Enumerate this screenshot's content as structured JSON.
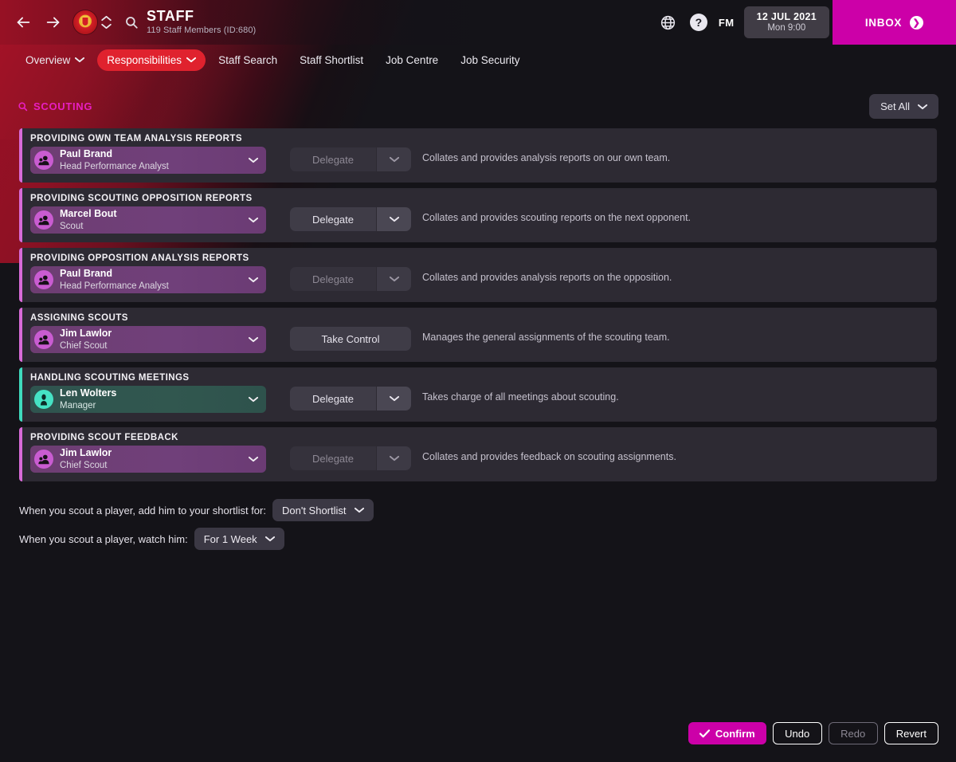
{
  "header": {
    "back_icon": "arrow-left-icon",
    "forward_icon": "arrow-right-icon",
    "club_badge": "manchester-united-badge",
    "spinner_icon": "club-switch-spinner",
    "search_icon": "search-icon",
    "title": "STAFF",
    "subtitle": "119 Staff Members (ID:680)",
    "globe_icon": "globe-icon",
    "help_icon": "help-question-icon",
    "fm_logo": "FM",
    "date_main": "12 JUL 2021",
    "date_sub": "Mon 9:00",
    "inbox_label": "INBOX",
    "inbox_icon": "chevron-right-circle-icon",
    "accent_pink": "#cc00a8",
    "accent_red": "#e0222e"
  },
  "tabs": [
    {
      "label": "Overview",
      "caret": true,
      "active": false
    },
    {
      "label": "Responsibilities",
      "caret": true,
      "active": true
    },
    {
      "label": "Staff Search",
      "caret": false,
      "active": false
    },
    {
      "label": "Staff Shortlist",
      "caret": false,
      "active": false
    },
    {
      "label": "Job Centre",
      "caret": false,
      "active": false
    },
    {
      "label": "Job Security",
      "caret": false,
      "active": false
    }
  ],
  "section": {
    "icon": "magnifier-icon",
    "title": "SCOUTING",
    "title_color": "#e81ec0",
    "set_all_label": "Set All",
    "set_all_caret": "chevron-down-icon"
  },
  "responsibilities": [
    {
      "label": "PROVIDING OWN TEAM ANALYSIS REPORTS",
      "person_name": "Paul Brand",
      "person_role": "Head Performance Analyst",
      "accent": "#d86bd8",
      "is_manager": false,
      "action_label": "Delegate",
      "action_dim": true,
      "has_caret": true,
      "description": "Collates and provides analysis reports on our own team."
    },
    {
      "label": "PROVIDING SCOUTING OPPOSITION REPORTS",
      "person_name": "Marcel Bout",
      "person_role": "Scout",
      "accent": "#d86bd8",
      "is_manager": false,
      "action_label": "Delegate",
      "action_dim": false,
      "has_caret": true,
      "description": "Collates and provides scouting reports on the next opponent."
    },
    {
      "label": "PROVIDING OPPOSITION ANALYSIS REPORTS",
      "person_name": "Paul Brand",
      "person_role": "Head Performance Analyst",
      "accent": "#d86bd8",
      "is_manager": false,
      "action_label": "Delegate",
      "action_dim": true,
      "has_caret": true,
      "description": "Collates and provides analysis reports on the opposition."
    },
    {
      "label": "ASSIGNING SCOUTS",
      "person_name": "Jim Lawlor",
      "person_role": "Chief Scout",
      "accent": "#d86bd8",
      "is_manager": false,
      "action_label": "Take Control",
      "action_dim": false,
      "has_caret": false,
      "description": "Manages the general assignments of the scouting team."
    },
    {
      "label": "HANDLING SCOUTING MEETINGS",
      "person_name": "Len Wolters",
      "person_role": "Manager",
      "accent": "#3fd9bd",
      "is_manager": true,
      "action_label": "Delegate",
      "action_dim": false,
      "has_caret": true,
      "description": "Takes charge of all meetings about scouting."
    },
    {
      "label": "PROVIDING SCOUT FEEDBACK",
      "person_name": "Jim Lawlor",
      "person_role": "Chief Scout",
      "accent": "#d86bd8",
      "is_manager": false,
      "action_label": "Delegate",
      "action_dim": true,
      "has_caret": true,
      "description": "Collates and provides feedback on scouting assignments."
    }
  ],
  "options": [
    {
      "text": "When you scout a player, add him to your shortlist for:",
      "value": "Don't Shortlist"
    },
    {
      "text": "When you scout a player, watch him:",
      "value": "For 1 Week"
    }
  ],
  "footer": {
    "confirm_label": "Confirm",
    "confirm_icon": "check-icon",
    "undo_label": "Undo",
    "redo_label": "Redo",
    "revert_label": "Revert",
    "redo_disabled": true
  }
}
